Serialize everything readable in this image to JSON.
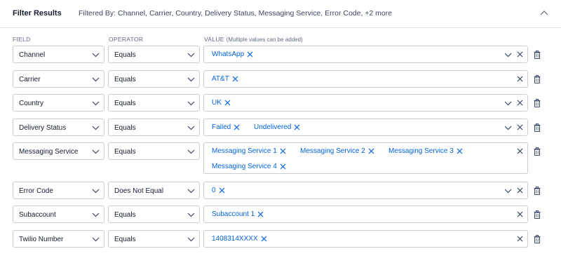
{
  "header": {
    "title": "Filter Results",
    "summary": "Filtered By: Channel, Carrier, Country, Delivery Status, Messaging Service, Error Code, +2 more"
  },
  "columns": {
    "field": "FIELD",
    "operator": "OPERATOR",
    "value": "VALUE",
    "value_hint": "(Multiple values can be added)"
  },
  "rows": [
    {
      "field": "Channel",
      "operator": "Equals",
      "values": [
        "WhatsApp"
      ]
    },
    {
      "field": "Carrier",
      "operator": "Equals",
      "values": [
        "AT&T"
      ]
    },
    {
      "field": "Country",
      "operator": "Equals",
      "values": [
        "UK"
      ]
    },
    {
      "field": "Delivery Status",
      "operator": "Equals",
      "values": [
        "Failed",
        "Undelivered"
      ]
    },
    {
      "field": "Messaging Service",
      "operator": "Equals",
      "values": [
        "Messaging Service 1",
        "Messaging Service 2",
        "Messaging Service 3",
        "Messaging Service 4"
      ]
    },
    {
      "field": "Error Code",
      "operator": "Does Not Equal",
      "values": [
        "0"
      ]
    },
    {
      "field": "Subaccount",
      "operator": "Equals",
      "values": [
        "Subaccount 1"
      ]
    },
    {
      "field": "Twilio Number",
      "operator": "Equals",
      "values": [
        "1408314XXXX"
      ]
    }
  ],
  "colors": {
    "chip_text": "#0263e0",
    "border": "#c9ccd6",
    "text": "#121c2d",
    "muted": "#606b85"
  },
  "icons": {
    "dropdown": "chevron-down-icon",
    "remove": "close-icon",
    "delete": "trash-icon",
    "collapse": "chevron-up-icon"
  }
}
